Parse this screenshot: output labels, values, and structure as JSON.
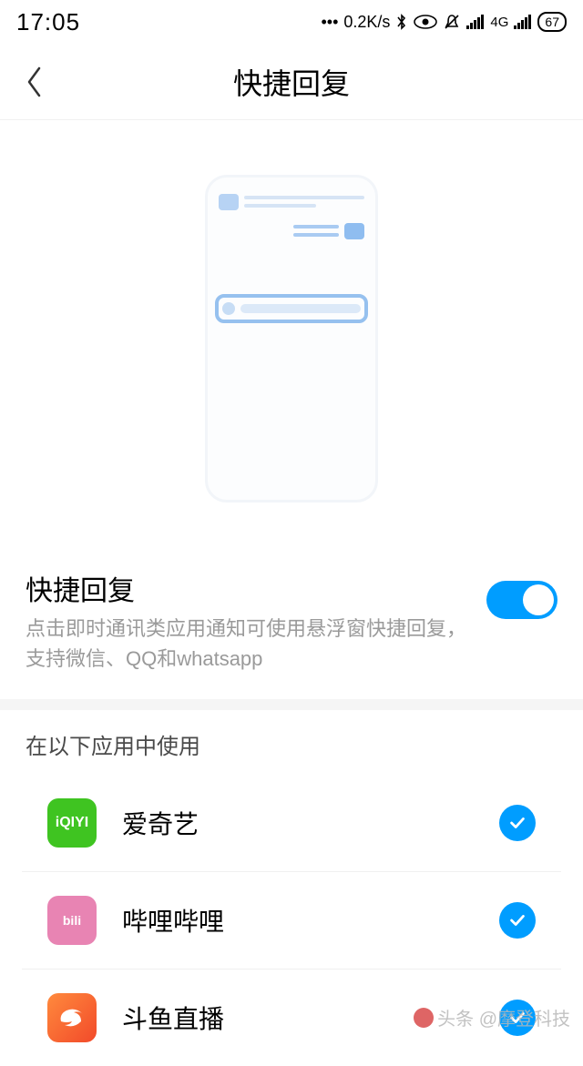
{
  "status": {
    "time": "17:05",
    "speed": "0.2K/s",
    "network": "4G",
    "battery": "67"
  },
  "header": {
    "title": "快捷回复"
  },
  "main_toggle": {
    "title": "快捷回复",
    "desc": "点击即时通讯类应用通知可使用悬浮窗快捷回复，支持微信、QQ和whatsapp"
  },
  "list_header": "在以下应用中使用",
  "apps": [
    {
      "name": "爱奇艺",
      "icon_key": "iqiyi",
      "icon_text": "iQIYI",
      "checked": true
    },
    {
      "name": "哔哩哔哩",
      "icon_key": "bilibili",
      "icon_text": "bili",
      "checked": true
    },
    {
      "name": "斗鱼直播",
      "icon_key": "douyu",
      "icon_text": "",
      "checked": true
    }
  ],
  "watermark": "头条 @摩登科技"
}
